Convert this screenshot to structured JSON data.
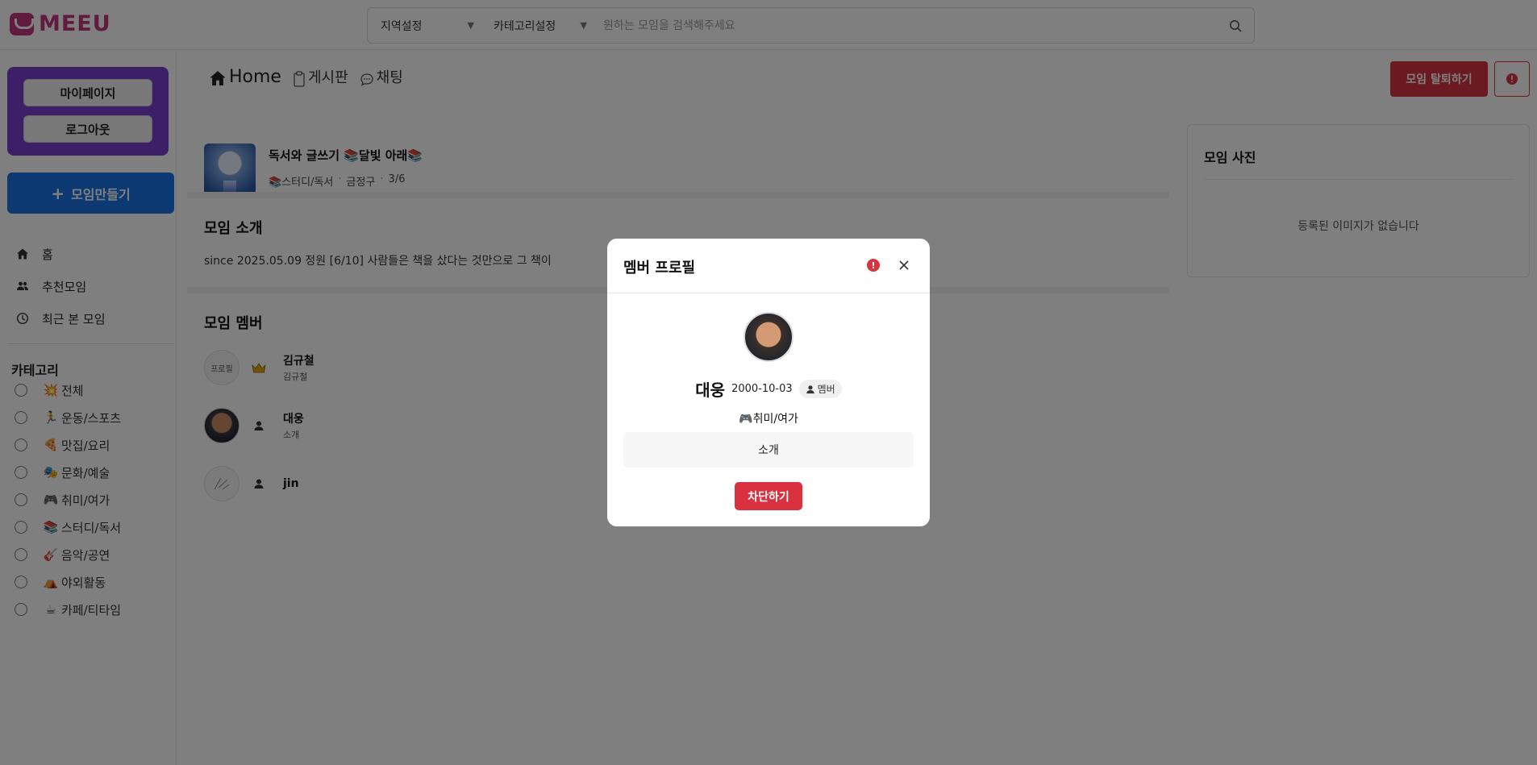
{
  "header": {
    "logo_text": "MEEU",
    "region_select": "지역설정",
    "category_select": "카테고리설정",
    "search_placeholder": "원하는 모임을 검색해주세요"
  },
  "sidebar": {
    "mypage_label": "마이페이지",
    "logout_label": "로그아웃",
    "create_label": "모임만들기",
    "nav": [
      {
        "label": "홈",
        "icon": "home-icon"
      },
      {
        "label": "추천모임",
        "icon": "people-icon"
      },
      {
        "label": "최근 본 모임",
        "icon": "clock-icon"
      }
    ],
    "category_title": "카테고리",
    "categories": [
      {
        "emoji": "💥",
        "label": "전체"
      },
      {
        "emoji": "🏃",
        "label": "운동/스포츠"
      },
      {
        "emoji": "🍕",
        "label": "맛집/요리"
      },
      {
        "emoji": "🎭",
        "label": "문화/예술"
      },
      {
        "emoji": "🎮",
        "label": "취미/여가"
      },
      {
        "emoji": "📚",
        "label": "스터디/독서"
      },
      {
        "emoji": "🎸",
        "label": "음악/공연"
      },
      {
        "emoji": "⛺",
        "label": "야외활동"
      },
      {
        "emoji": "☕",
        "label": "카페/티타임"
      }
    ]
  },
  "main": {
    "tabs": [
      {
        "label": "Home"
      },
      {
        "label": "게시판"
      },
      {
        "label": "채팅"
      }
    ],
    "leave_label": "모임 탈퇴하기",
    "group": {
      "name": "독서와 글쓰기 📚달빛 아래📚",
      "category": "📚스터디/독서",
      "location": "금정구",
      "members_count": "3/6"
    },
    "intro_title": "모임 소개",
    "intro_text": "since 2025.05.09 정원 [6/10] 사람들은 책을 샀다는 것만으로 그 책이",
    "members_title": "모임 멤버",
    "members": [
      {
        "name": "김규철",
        "sub": "김규철",
        "avatar_alt": "프로필",
        "role_icon": "crown-icon"
      },
      {
        "name": "대웅",
        "sub": "소개",
        "avatar_alt": "",
        "role_icon": "member-icon"
      },
      {
        "name": "jin",
        "sub": "",
        "avatar_alt": "",
        "role_icon": "member-icon"
      }
    ],
    "photo_title": "모임 사진",
    "photo_empty": "등록된 이미지가 없습니다"
  },
  "modal": {
    "title": "멤버 프로필",
    "report_label": "!",
    "name": "대웅",
    "birth": "2000-10-03",
    "role": "멤버",
    "category": "🎮취미/여가",
    "intro": "소개",
    "block_label": "차단하기"
  },
  "colors": {
    "brand": "#c0367f",
    "primary": "#1b73e6",
    "danger": "#d53440",
    "sidebar_box": "#7b3fd0"
  }
}
